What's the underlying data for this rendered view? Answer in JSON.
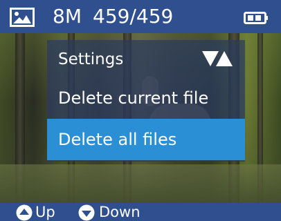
{
  "status_bar": {
    "resolution": "8M",
    "counter": "459/459",
    "image_icon": "image-icon",
    "battery_icon": "battery-icon"
  },
  "menu": {
    "title": "Settings",
    "title_icon": "up-down-arrows-icon",
    "items": [
      {
        "label": "Delete current file",
        "selected": false
      },
      {
        "label": "Delete all files",
        "selected": true
      }
    ]
  },
  "footer": {
    "up_label": "Up",
    "down_label": "Down"
  },
  "colors": {
    "bar": "#2f4f8f",
    "selected": "#2a8fd4",
    "menu_panel": "#2a3a5f"
  }
}
